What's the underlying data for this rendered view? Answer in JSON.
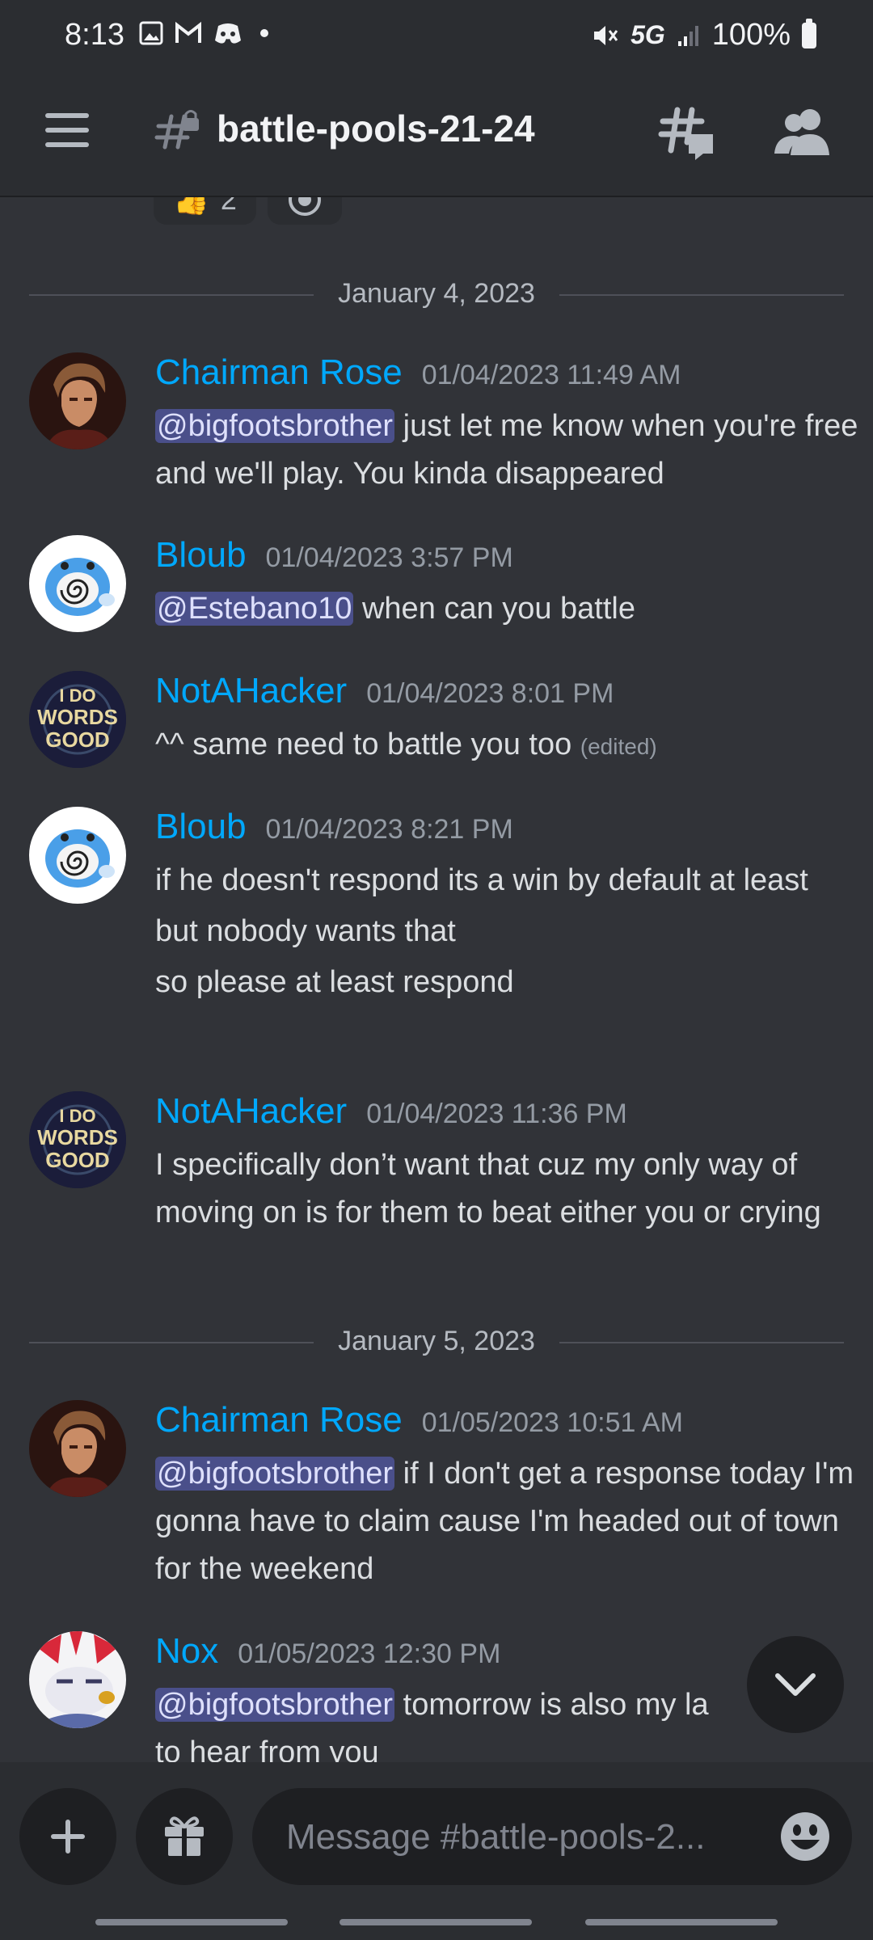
{
  "status_bar": {
    "time": "8:13",
    "network": "5G",
    "battery": "100%"
  },
  "header": {
    "channel_name": "battle-pools-21-24"
  },
  "reactions": [
    {
      "emoji": "👍",
      "count": "2"
    }
  ],
  "dividers": [
    "January 4, 2023",
    "January 5, 2023"
  ],
  "messages": [
    {
      "author": "Chairman Rose",
      "timestamp": "01/04/2023 11:49 AM",
      "mention": "@bigfootsbrother",
      "text": " just let me know when you're free and we'll play. You kinda disappeared"
    },
    {
      "author": "Bloub",
      "timestamp": "01/04/2023 3:57 PM",
      "mention": "@Estebano10",
      "text": " when can you battle"
    },
    {
      "author": "NotAHacker",
      "timestamp": "01/04/2023 8:01 PM",
      "text": "^^ same need to battle you too",
      "edited": "(edited)"
    },
    {
      "author": "Bloub",
      "timestamp": "01/04/2023 8:21 PM",
      "lines": [
        "if he doesn't respond its a win by default at least",
        "but nobody wants that",
        "so please at least respond"
      ]
    },
    {
      "author": "NotAHacker",
      "timestamp": "01/04/2023 11:36 PM",
      "text": "I specifically don’t want that cuz my only way of moving on is for them to beat either you or crying"
    },
    {
      "author": "Chairman Rose",
      "timestamp": "01/05/2023 10:51 AM",
      "mention": "@bigfootsbrother",
      "text": " if I don't get a response today I'm gonna have to claim cause I'm headed out of town for the weekend"
    },
    {
      "author": "Nox",
      "timestamp": "01/05/2023 12:30 PM",
      "mention": "@bigfootsbrother",
      "text": " tomorrow is also my la",
      "text2": "to hear from you"
    }
  ],
  "avatar_text": {
    "notahacker": [
      "I DO",
      "WORDS",
      "GOOD"
    ]
  },
  "composer": {
    "placeholder": "Message #battle-pools-2..."
  },
  "colors": {
    "background": "#313338",
    "header": "#2b2d31",
    "author": "#00a8fc",
    "mention_bg": "#4a4f8a"
  },
  "icons": [
    "menu-icon",
    "hash-lock-icon",
    "threads-icon",
    "members-icon",
    "chevron-down-icon",
    "plus-icon",
    "gift-icon",
    "emoji-icon"
  ]
}
